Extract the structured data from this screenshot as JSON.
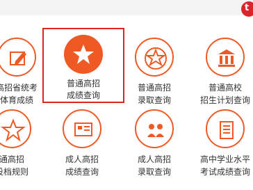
{
  "header": {
    "badge_icon": "brand-logo-icon",
    "badge_glyph": "t",
    "accent_color": "#ef5a24",
    "selection_color": "#e0261c"
  },
  "tiles": [
    {
      "icon": "edit-icon",
      "line1": "高招省统考",
      "line2": "体育成绩"
    },
    {
      "icon": "star-icon",
      "line1": "普通高招",
      "line2": "成绩查询",
      "selected": true
    },
    {
      "icon": "star-badge-icon",
      "line1": "普通高招",
      "line2": "录取查询"
    },
    {
      "icon": "institution-icon",
      "line1": "普通高校",
      "line2": "招生计划查询"
    },
    {
      "icon": "star-outline-icon",
      "line1": "通高招",
      "line2": "投档规则"
    },
    {
      "icon": "certificate-icon",
      "line1": "成人高招",
      "line2": "成绩查询"
    },
    {
      "icon": "people-icon",
      "line1": "成人高招",
      "line2": "录取查询"
    },
    {
      "icon": "document-icon",
      "line1": "高中学业水平",
      "line2": "考试成绩查询"
    }
  ]
}
